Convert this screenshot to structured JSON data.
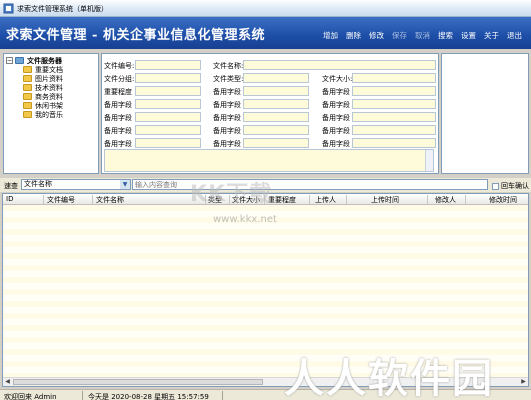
{
  "window": {
    "title": "求索文件管理系统（单机版）"
  },
  "banner": {
    "heading": "求索文件管理 - 机关企事业信息化管理系统",
    "menu": [
      {
        "label": "增加",
        "enabled": true
      },
      {
        "label": "删除",
        "enabled": true
      },
      {
        "label": "修改",
        "enabled": true
      },
      {
        "label": "保存",
        "enabled": false
      },
      {
        "label": "取消",
        "enabled": false
      },
      {
        "label": "搜索",
        "enabled": true
      },
      {
        "label": "设置",
        "enabled": true
      },
      {
        "label": "关于",
        "enabled": true
      },
      {
        "label": "退出",
        "enabled": true
      }
    ]
  },
  "tree": {
    "root": "文件服务器",
    "items": [
      "重要文档",
      "图片资料",
      "技术资料",
      "商务资料",
      "休闲书架",
      "我的音乐"
    ]
  },
  "form": {
    "file_no": "文件编号:",
    "file_name": "文件名称:",
    "category": "文件分组:",
    "file_type": "文件类型:",
    "file_size": "文件大小:",
    "importance": "重要程度",
    "spare": "备用字段"
  },
  "search": {
    "label": "速查",
    "field": "文件名称",
    "placeholder": "输入内容查询",
    "enter_label": "回车确认"
  },
  "grid": {
    "columns": [
      "ID",
      "文件编号",
      "文件名称",
      "类型",
      "文件大小",
      "重要程度",
      "上传人",
      "上传时间",
      "修改人",
      "修改时间"
    ]
  },
  "status": {
    "welcome": "欢迎回来 Admin",
    "date": "今天是 2020-08-28 星期五 15:57:59"
  },
  "watermarks": {
    "main": "KK下载",
    "url": "www.kkx.net",
    "brand": "人人软件园"
  }
}
